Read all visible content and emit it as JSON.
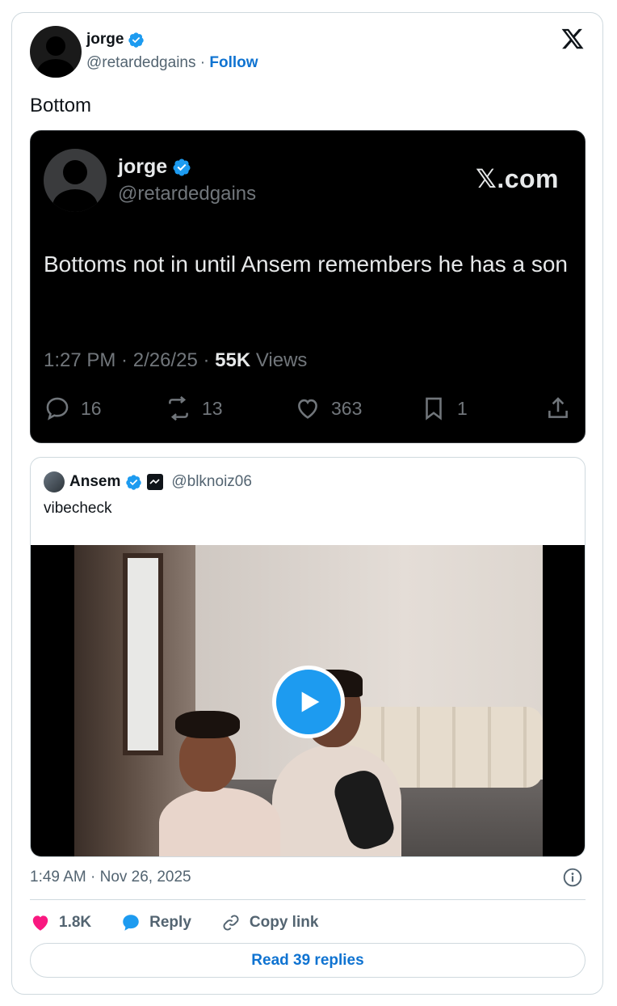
{
  "header": {
    "name": "jorge",
    "handle": "@retardedgains",
    "separator": "·",
    "follow_label": "Follow"
  },
  "tweet": {
    "text": "Bottom"
  },
  "embedded": {
    "name": "jorge",
    "handle": "@retardedgains",
    "site": "𝕏.com",
    "text": "Bottoms not in until Ansem remembers he has a son",
    "time": "1:27 PM",
    "date": "2/26/25",
    "views_count": "55K",
    "views_label": "Views",
    "replies": "16",
    "reposts": "13",
    "likes": "363",
    "bookmarks": "1"
  },
  "quote": {
    "name": "Ansem",
    "handle": "@blknoiz06",
    "text": "vibecheck"
  },
  "footer": {
    "timestamp": "1:49 AM · Nov 26, 2025",
    "likes": "1.8K",
    "reply_label": "Reply",
    "copy_label": "Copy link",
    "read_replies": "Read 39 replies"
  },
  "colors": {
    "accent": "#1d9bf0",
    "link": "#0f73d1",
    "like": "#f91880"
  }
}
